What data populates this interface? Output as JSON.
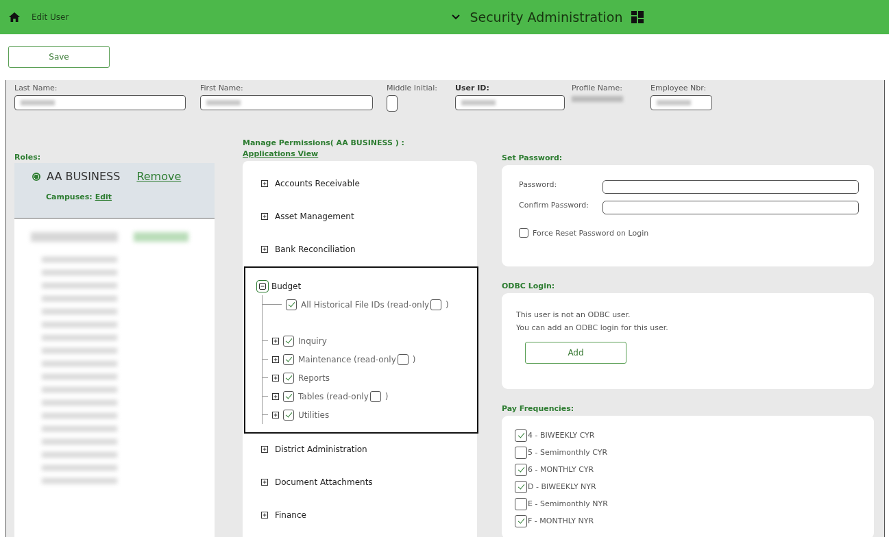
{
  "header": {
    "page_title": "Edit User",
    "app_title": "Security Administration"
  },
  "toolbar": {
    "buttons": [
      "Save"
    ]
  },
  "user_fields": [
    {
      "label": "Last Name:",
      "kind": "wide",
      "bold": false
    },
    {
      "label": "First Name:",
      "kind": "wide",
      "bold": false
    },
    {
      "label": "Middle Initial:",
      "kind": "initial",
      "bold": false
    },
    {
      "label": "User ID:",
      "kind": "medium",
      "bold": true
    },
    {
      "label": "Profile Name:",
      "kind": "plain",
      "bold": false
    },
    {
      "label": "Employee Nbr:",
      "kind": "small",
      "bold": false
    }
  ],
  "roles": {
    "title": "Roles:",
    "items": [
      {
        "name": "AA BUSINESS",
        "selected": true,
        "action": "Remove",
        "campuses_label": "Campuses:",
        "campuses_link": "Edit"
      }
    ]
  },
  "permissions": {
    "title": "Manage Permissions( AA BUSINESS ) :",
    "view_link": "Applications View",
    "applications": [
      {
        "label": "Accounts Receivable",
        "expanded": false,
        "selected": false
      },
      {
        "label": "Asset Management",
        "expanded": false,
        "selected": false
      },
      {
        "label": "Bank Reconciliation",
        "expanded": false,
        "selected": false
      },
      {
        "label": "Budget",
        "expanded": true,
        "selected": true,
        "children": [
          {
            "label": "All Historical File IDs (read-only",
            "checked": true,
            "expandable": false,
            "readonly_checked": false,
            "close": ")"
          },
          {
            "label": "Inquiry",
            "checked": true,
            "expandable": true
          },
          {
            "label": "Maintenance (read-only",
            "checked": true,
            "expandable": true,
            "readonly_checked": false,
            "close": ")"
          },
          {
            "label": "Reports",
            "checked": true,
            "expandable": true
          },
          {
            "label": "Tables (read-only",
            "checked": true,
            "expandable": true,
            "readonly_checked": false,
            "close": ")"
          },
          {
            "label": "Utilities",
            "checked": true,
            "expandable": true
          }
        ]
      },
      {
        "label": "District Administration",
        "expanded": false,
        "selected": false
      },
      {
        "label": "Document Attachments",
        "expanded": false,
        "selected": false
      },
      {
        "label": "Finance",
        "expanded": false,
        "selected": false
      }
    ]
  },
  "set_password": {
    "title": "Set Password:",
    "fields": [
      {
        "label": "Password:"
      },
      {
        "label": "Confirm Password:"
      }
    ],
    "force_reset": {
      "label": "Force Reset Password on Login",
      "checked": false
    }
  },
  "odbc_login": {
    "title": "ODBC Login:",
    "lines": [
      "This user is not an ODBC user.",
      "You can add an ODBC login for this user."
    ],
    "button": "Add"
  },
  "pay_frequencies": {
    "title": "Pay Frequencies:",
    "items": [
      {
        "label": "4 - BIWEEKLY CYR",
        "checked": true
      },
      {
        "label": "5 - Semimonthly CYR",
        "checked": false
      },
      {
        "label": "6 - MONTHLY CYR",
        "checked": true
      },
      {
        "label": "D - BIWEEKLY NYR",
        "checked": true
      },
      {
        "label": "E - Semimonthly NYR",
        "checked": false
      },
      {
        "label": "F - MONTHLY NYR",
        "checked": true
      }
    ]
  }
}
